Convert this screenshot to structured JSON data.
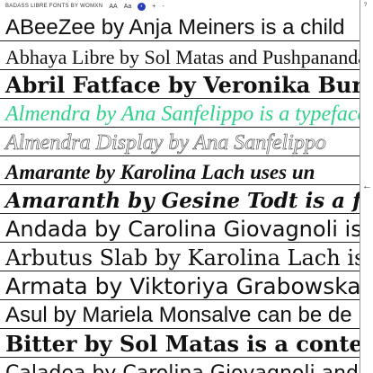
{
  "toolbar": {
    "title": "BADASS LIBRE FONTS BY WOMXN",
    "size_toggle": "AA",
    "case_toggle": "Aa",
    "mode_badge": "◐",
    "plus_label": "+",
    "minus_label": "-"
  },
  "sidebar": {
    "help_label": "?",
    "expand_label": "←"
  },
  "fonts": [
    "ABeeZee by Anja Meiners is a child",
    "Abhaya Libre by Sol Matas and Pushpananda Ekanayake",
    "Abril Fatface by Veronika Burian",
    "Almendra by Ana Sanfelippo is a typeface",
    "Almendra Display by Ana Sanfelippo",
    "Amarante by Karolina Lach uses un",
    "Amaranth by Gesine Todt is a friendly",
    "Andada by Carolina Giovagnoli is a",
    "Arbutus Slab by Karolina Lach is",
    "Armata by Viktoriya Grabowska",
    "Asul by Mariela Monsalve can be de",
    "Bitter by Sol Matas is a contemporary",
    "Caladea by Carolina Giovagnoli and"
  ]
}
